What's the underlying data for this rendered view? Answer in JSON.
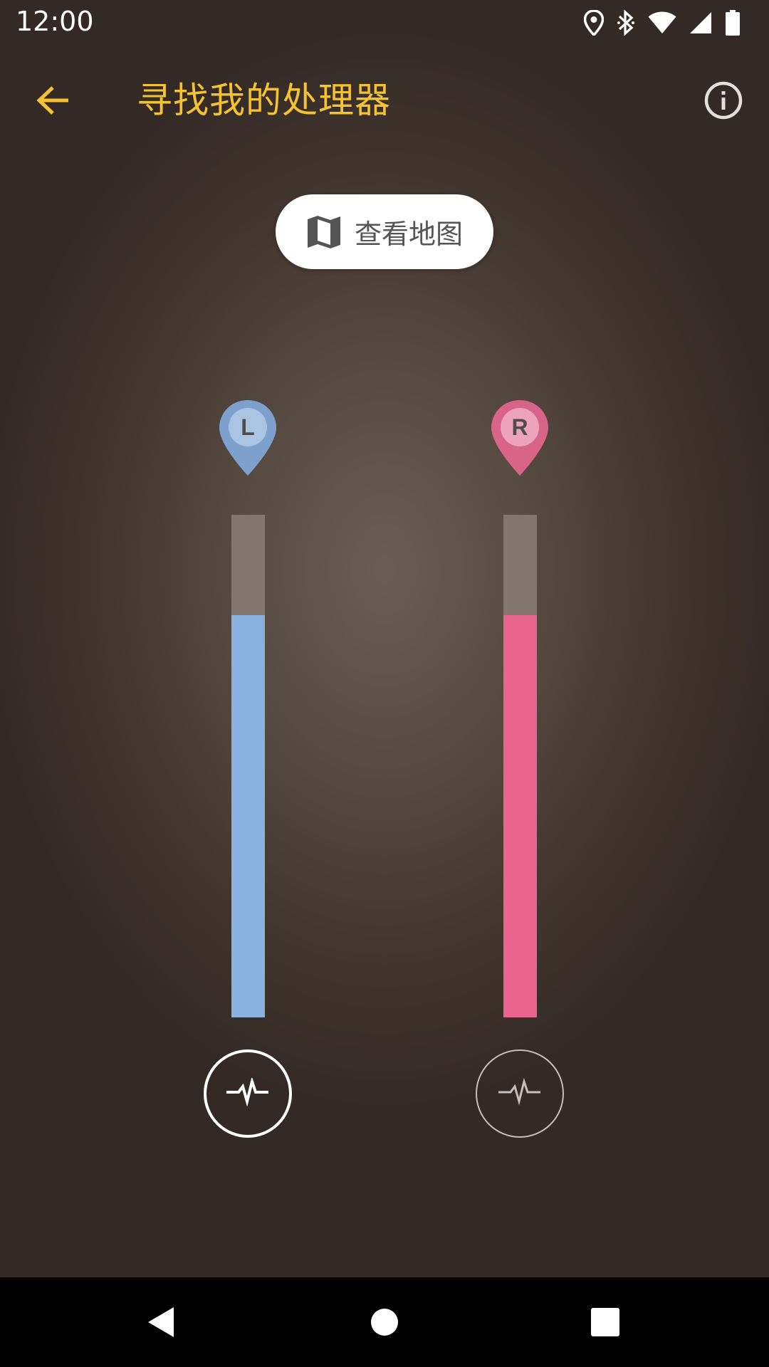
{
  "status_bar": {
    "time": "12:00",
    "icons": [
      "location-icon",
      "bluetooth-icon",
      "wifi-icon",
      "signal-icon",
      "battery-icon"
    ]
  },
  "app_bar": {
    "title": "寻找我的处理器",
    "back_icon": "arrow-back-icon",
    "info_icon": "info-icon"
  },
  "map_button": {
    "label": "查看地图",
    "icon": "map-icon"
  },
  "sides": {
    "left": {
      "letter": "L",
      "pin_color": "#7da1cc",
      "letter_badge_color": "#aac4e3",
      "bar_color": "#8ab2de",
      "signal_level": 0.8,
      "pulse_active": true
    },
    "right": {
      "letter": "R",
      "pin_color": "#d9648a",
      "letter_badge_color": "#eea3bc",
      "bar_color": "#ea6490",
      "signal_level": 0.8,
      "pulse_active": false
    }
  },
  "colors": {
    "accent": "#f5c232",
    "background": "#4e4239",
    "meter_track": "#82766e"
  },
  "nav_bar": {
    "icons": [
      "nav-back-icon",
      "nav-home-icon",
      "nav-recents-icon"
    ]
  }
}
